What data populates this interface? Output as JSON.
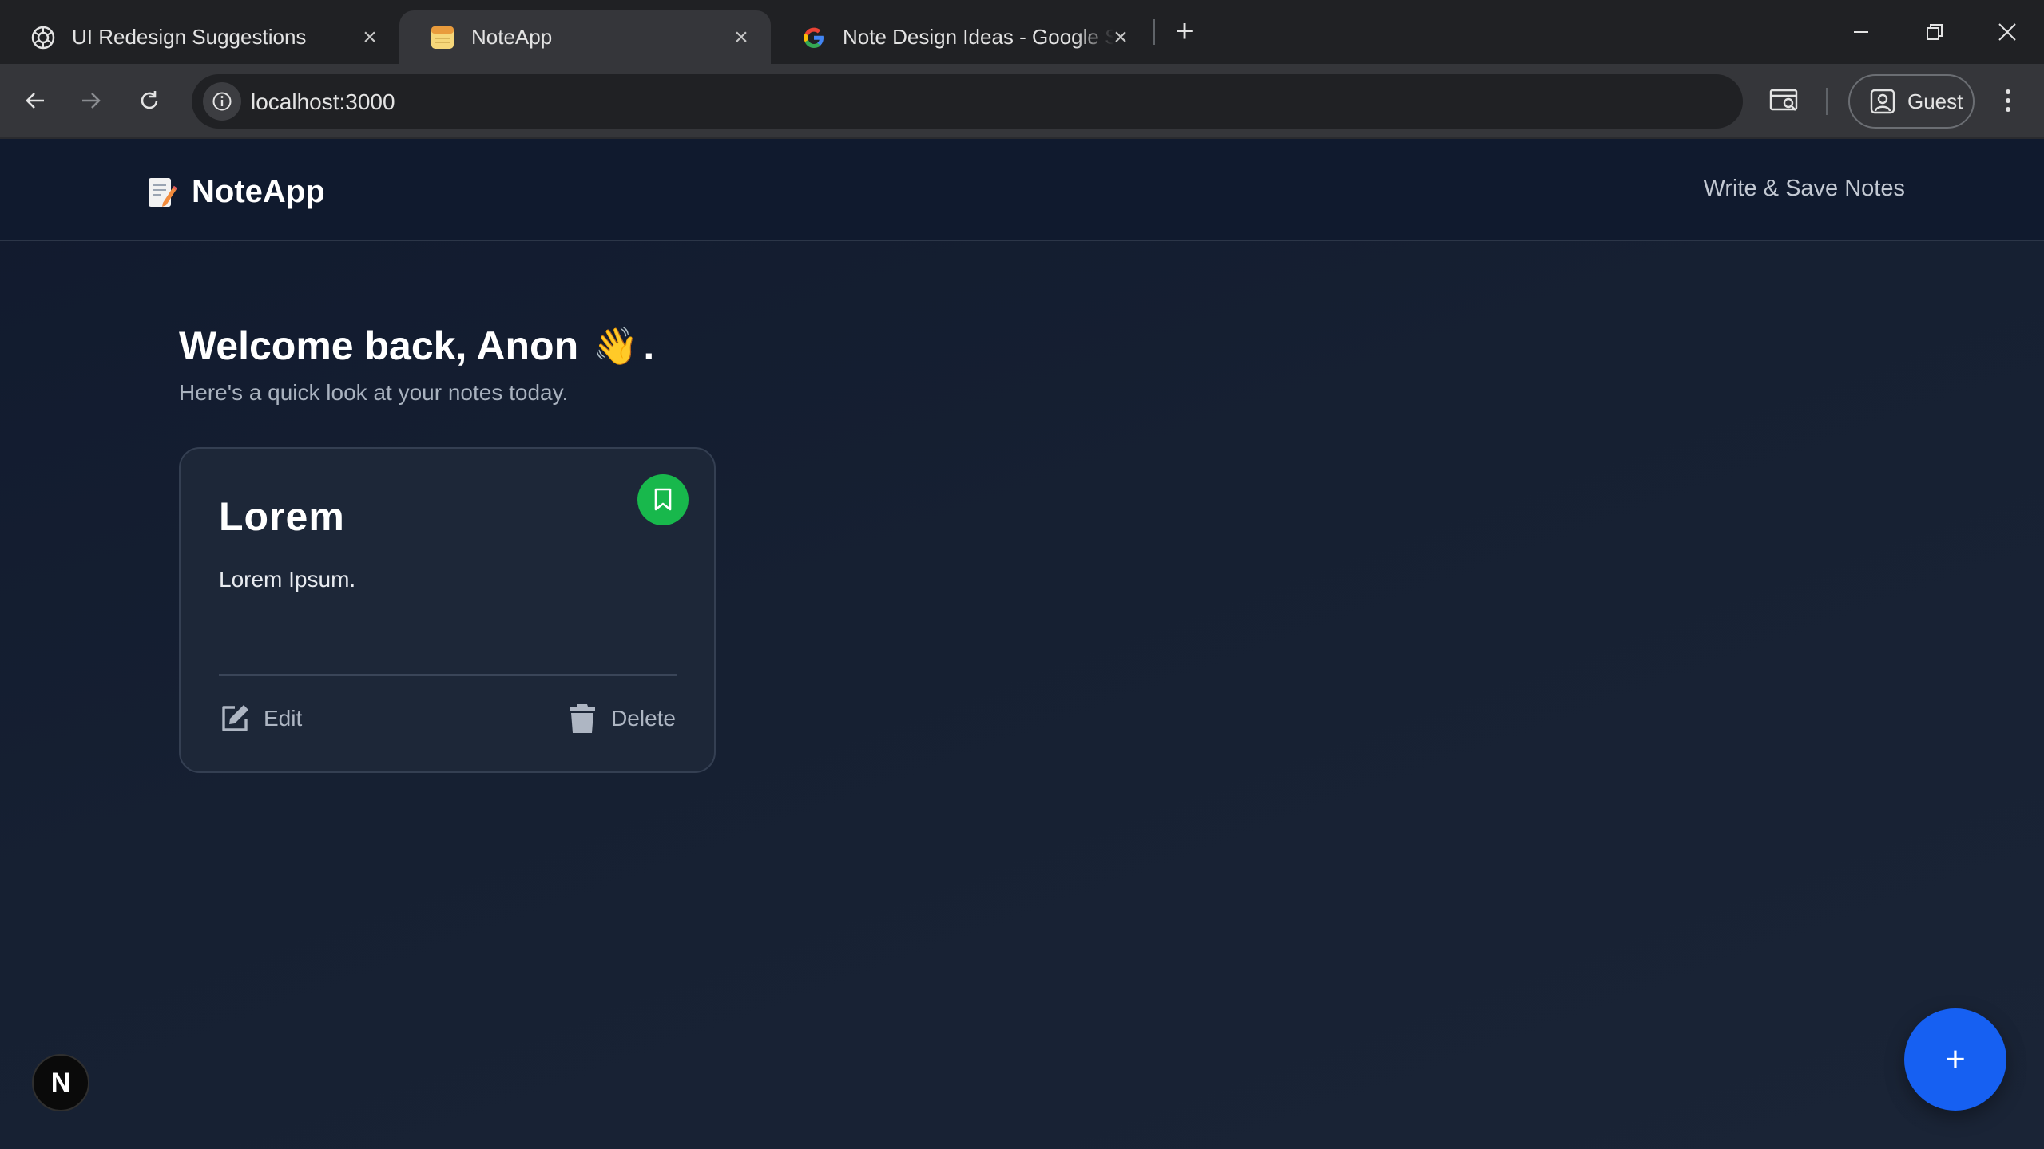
{
  "browser": {
    "tabs": [
      {
        "title": "UI Redesign Suggestions",
        "icon": "openai-logo-icon",
        "active": false
      },
      {
        "title": "NoteApp",
        "icon": "notepad-favicon-icon",
        "active": true
      },
      {
        "title": "Note Design Ideas - Google Search",
        "icon": "google-g-icon",
        "active": false
      }
    ],
    "url": "localhost:3000",
    "profile_label": "Guest"
  },
  "app": {
    "brand_name": "NoteApp",
    "header_link": "Write & Save Notes",
    "welcome_text": "Welcome back, Anon",
    "welcome_emoji": "👋",
    "welcome_punct": ".",
    "subtitle": "Here's a quick look at your notes today.",
    "notes": [
      {
        "title": "Lorem",
        "body": "Lorem Ipsum.",
        "bookmarked": true,
        "edit_label": "Edit",
        "delete_label": "Delete"
      }
    ],
    "fab_label": "+",
    "dev_badge": "N"
  },
  "colors": {
    "accent_blue": "#1660f2",
    "bookmark_green": "#18b84c",
    "background": "#151c2b",
    "card": "#1d2738"
  }
}
